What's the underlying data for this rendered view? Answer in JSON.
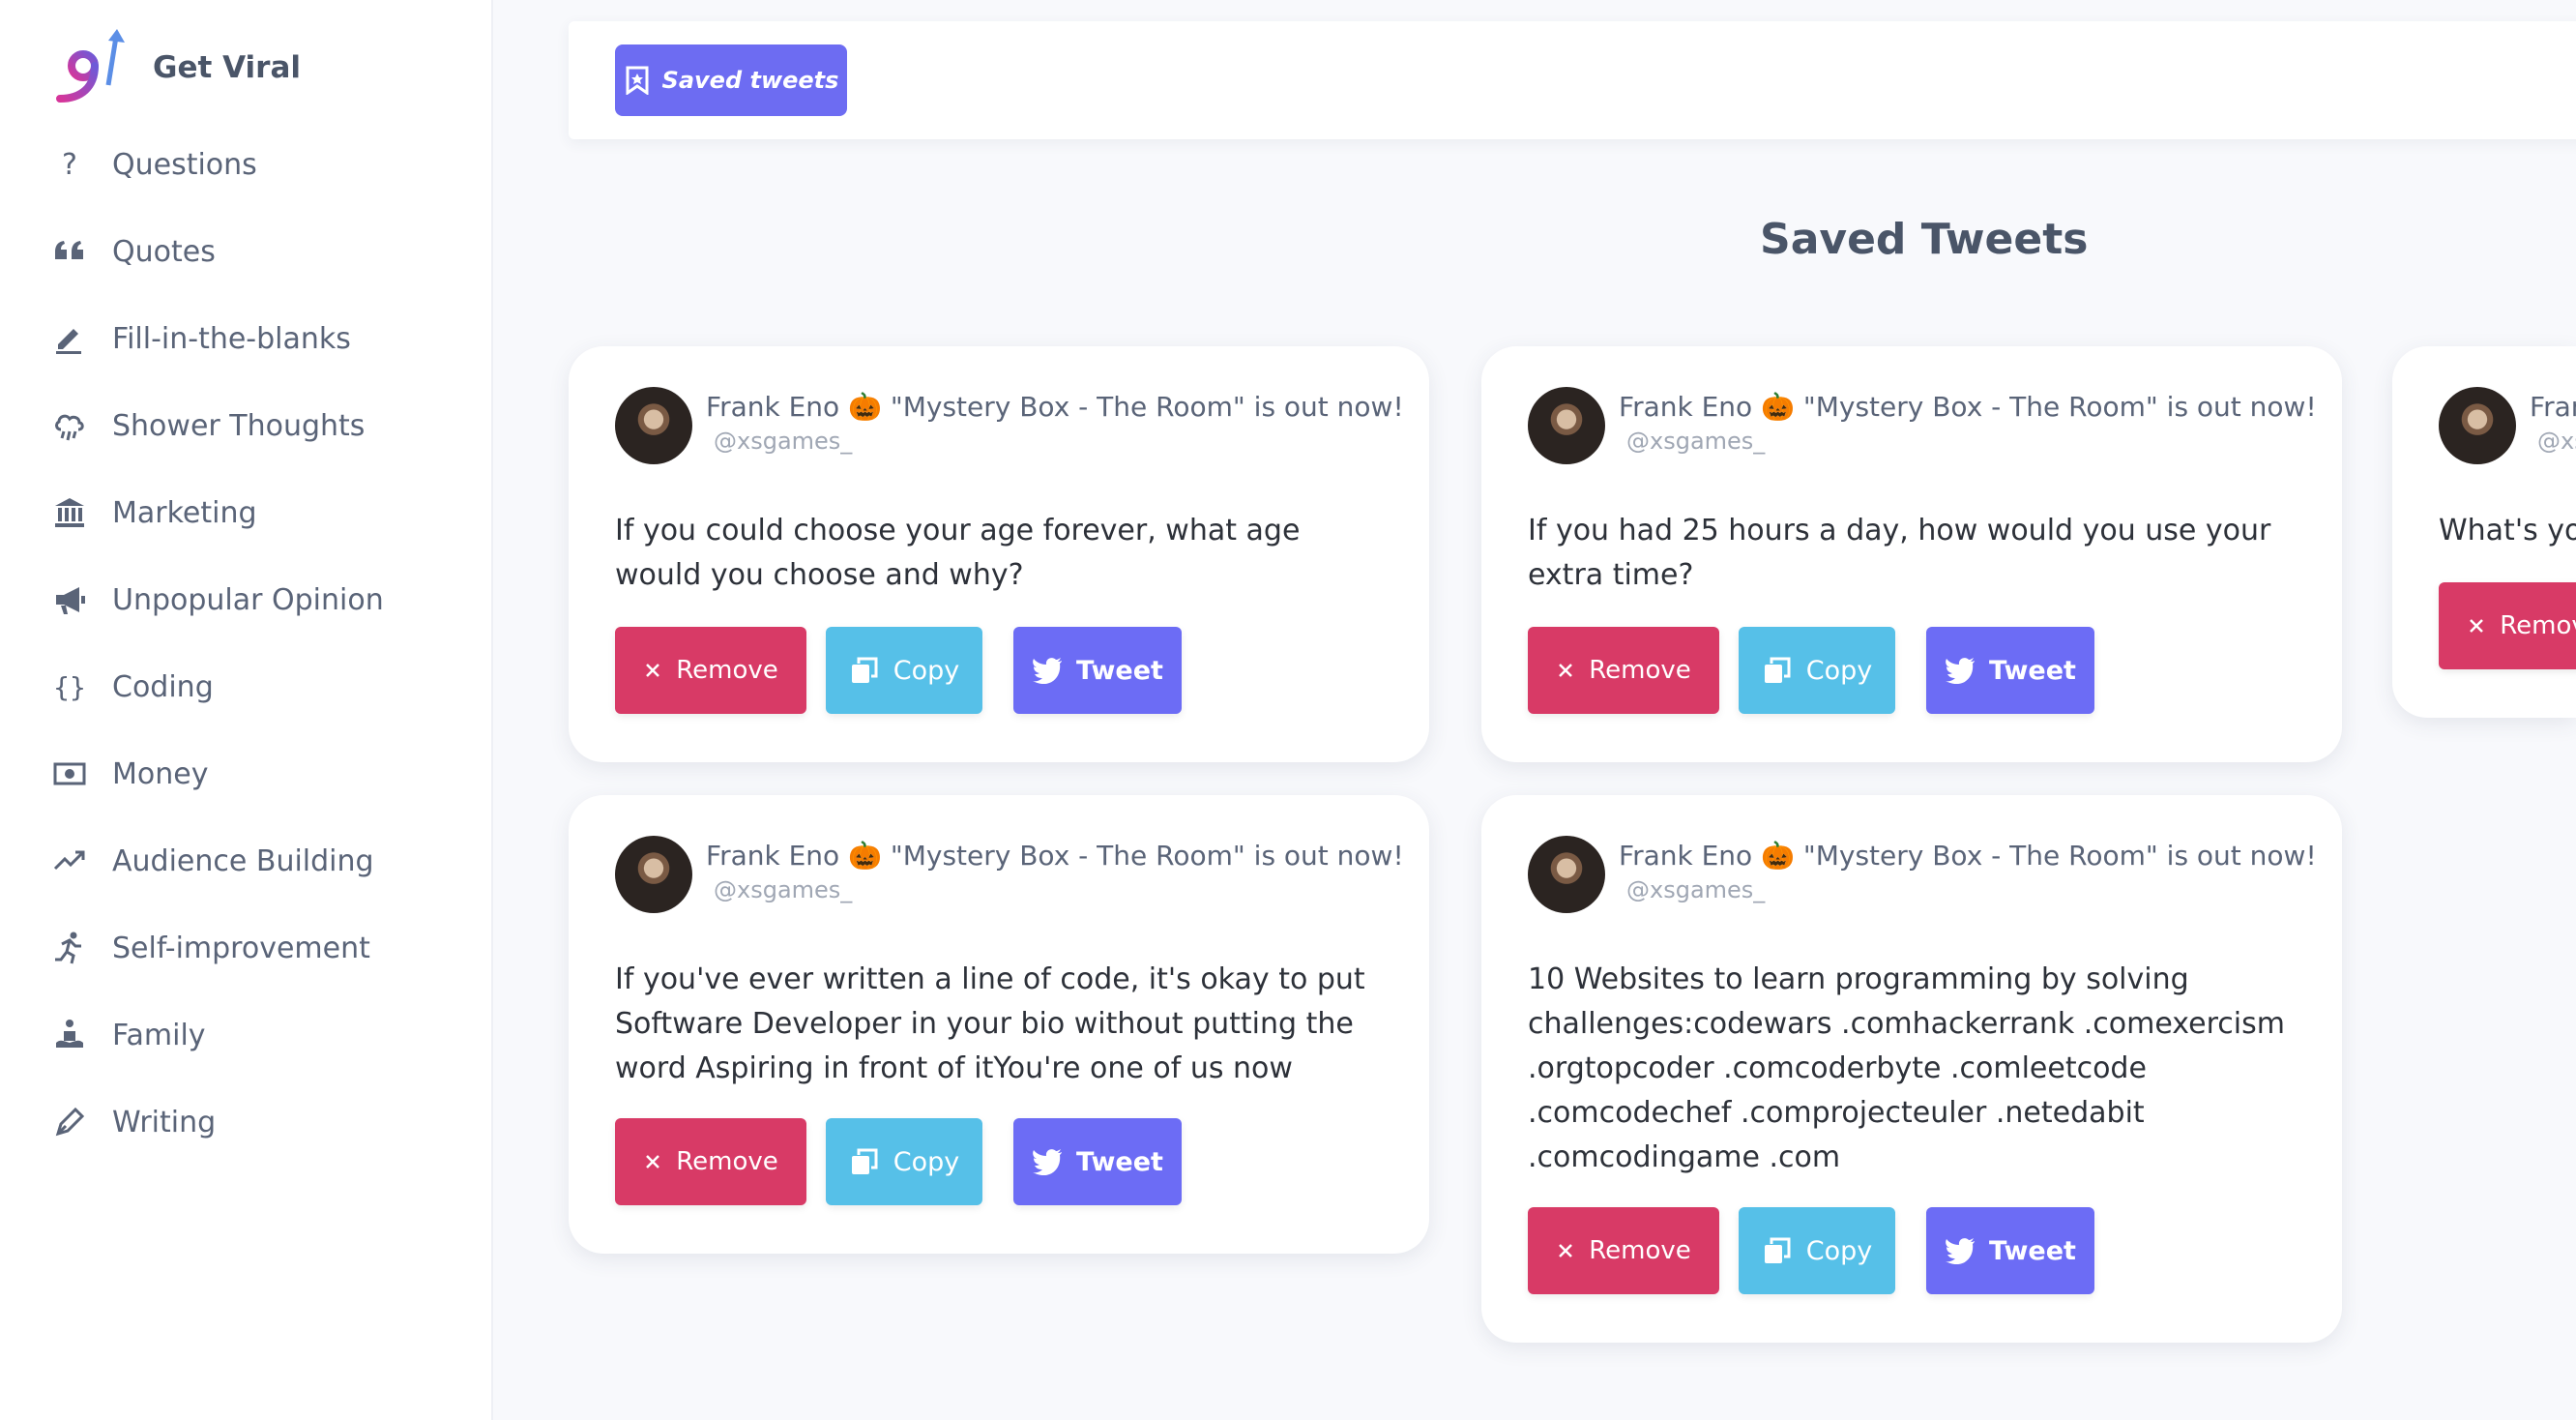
{
  "brand": {
    "name": "Get Viral"
  },
  "sidebar": {
    "items": [
      {
        "label": "Questions",
        "icon": "question-icon"
      },
      {
        "label": "Quotes",
        "icon": "quote-icon"
      },
      {
        "label": "Fill-in-the-blanks",
        "icon": "pencil-icon"
      },
      {
        "label": "Shower Thoughts",
        "icon": "cloud-rain-icon"
      },
      {
        "label": "Marketing",
        "icon": "bank-icon"
      },
      {
        "label": "Unpopular Opinion",
        "icon": "megaphone-icon"
      },
      {
        "label": "Coding",
        "icon": "braces-icon"
      },
      {
        "label": "Money",
        "icon": "money-icon"
      },
      {
        "label": "Audience Building",
        "icon": "trending-up-icon"
      },
      {
        "label": "Self-improvement",
        "icon": "running-icon"
      },
      {
        "label": "Family",
        "icon": "family-icon"
      },
      {
        "label": "Writing",
        "icon": "pen-icon"
      }
    ]
  },
  "topbar": {
    "saved_label": "Saved tweets"
  },
  "page": {
    "title": "Saved Tweets"
  },
  "actions": {
    "remove": "Remove",
    "copy": "Copy",
    "tweet": "Tweet"
  },
  "tweets": [
    {
      "name": "Frank Eno 🎃 \"Mystery Box - The Room\" is out now!",
      "handle": "@xsgames_",
      "text": "If you could choose your age forever, what age would you choose and why?"
    },
    {
      "name": "Frank Eno 🎃 \"Mystery Box - The Room\" is out now!",
      "handle": "@xsgames_",
      "text": "If you had 25 hours a day, how would you use your extra time?"
    },
    {
      "name": "Frank Eno 🎃 \"Mystery Box - The Room\" is out now!",
      "handle": "@xsgames_",
      "text": "What's your"
    },
    {
      "name": "Frank Eno 🎃 \"Mystery Box - The Room\" is out now!",
      "handle": "@xsgames_",
      "text": "If you've ever written a line of code, it's okay to put Software Developer in your bio without putting the word Aspiring in front of itYou're one of us now"
    },
    {
      "name": "Frank Eno 🎃 \"Mystery Box - The Room\" is out now!",
      "handle": "@xsgames_",
      "text": "10 Websites to learn programming by solving challenges:codewars .comhackerrank .comexercism .orgtopcoder .comcoderbyte .comleetcode .comcodechef .comprojecteuler .netedabit .comcodingame .com"
    }
  ],
  "colors": {
    "accent": "#6d6cf2",
    "remove": "#d83a66",
    "copy": "#56c0e8",
    "tweet": "#6c6cf5"
  }
}
